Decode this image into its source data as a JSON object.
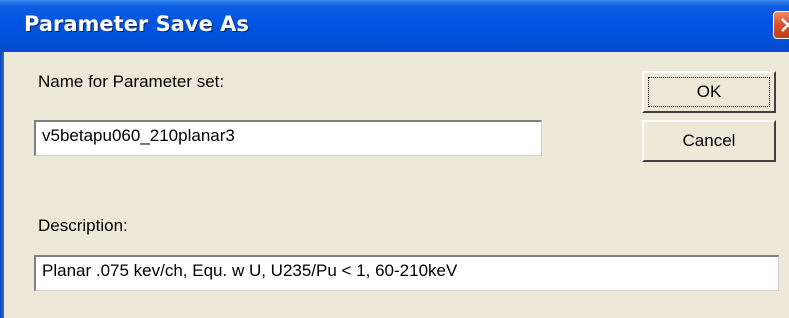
{
  "dialog": {
    "title": "Parameter Save As",
    "close_icon": "close-icon"
  },
  "form": {
    "name_label": "Name for Parameter set:",
    "name_value": "v5betapu060_210planar3",
    "description_label": "Description:",
    "description_value": "Planar .075 kev/ch, Equ. w U,  U235/Pu < 1, 60-210keV"
  },
  "buttons": {
    "ok_label": "OK",
    "cancel_label": "Cancel"
  },
  "colors": {
    "titlebar": "#0054e3",
    "dialog_bg": "#ece9d8",
    "close_button": "#d9502c"
  }
}
